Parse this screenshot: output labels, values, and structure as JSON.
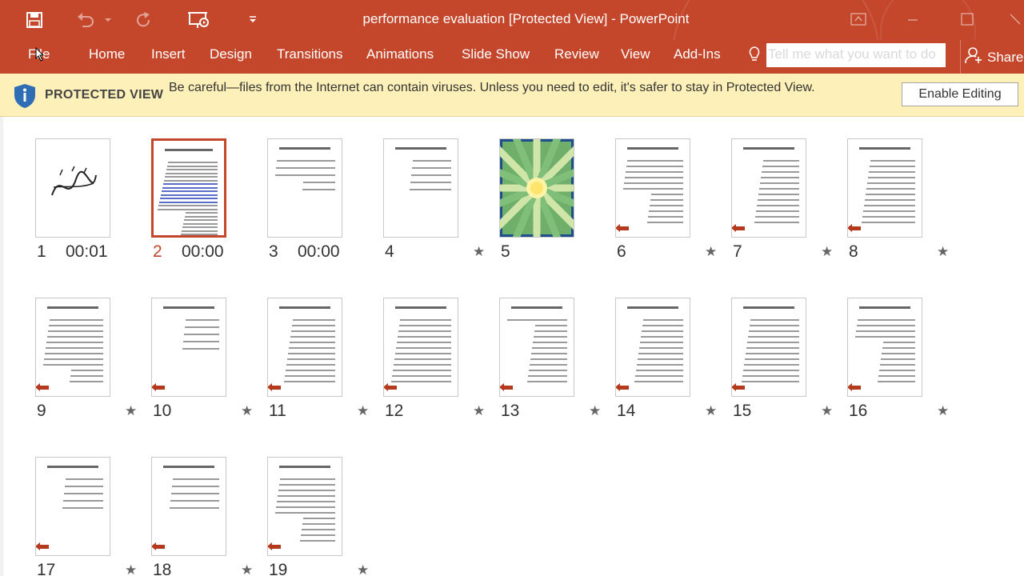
{
  "window": {
    "title": "performance evaluation [Protected View] - PowerPoint"
  },
  "ribbon": {
    "tabs": [
      "File",
      "Home",
      "Insert",
      "Design",
      "Transitions",
      "Animations",
      "Slide Show",
      "Review",
      "View",
      "Add-Ins"
    ],
    "tell_me_placeholder": "Tell me what you want to do",
    "share_label": "Share"
  },
  "protected_view": {
    "title": "PROTECTED VIEW",
    "message": "Be careful—files from the Internet can contain viruses. Unless you need to edit, it's safer to stay in Protected View.",
    "button": "Enable Editing"
  },
  "slides": [
    {
      "num": "1",
      "time": "00:01",
      "star": false
    },
    {
      "num": "2",
      "time": "00:00",
      "star": false,
      "selected": true
    },
    {
      "num": "3",
      "time": "00:00",
      "star": false
    },
    {
      "num": "4",
      "time": "",
      "star": true
    },
    {
      "num": "5",
      "time": "",
      "star": false
    },
    {
      "num": "6",
      "time": "",
      "star": true
    },
    {
      "num": "7",
      "time": "",
      "star": true
    },
    {
      "num": "8",
      "time": "",
      "star": true
    },
    {
      "num": "9",
      "time": "",
      "star": true
    },
    {
      "num": "10",
      "time": "",
      "star": true
    },
    {
      "num": "11",
      "time": "",
      "star": true
    },
    {
      "num": "12",
      "time": "",
      "star": true
    },
    {
      "num": "13",
      "time": "",
      "star": true
    },
    {
      "num": "14",
      "time": "",
      "star": true
    },
    {
      "num": "15",
      "time": "",
      "star": true
    },
    {
      "num": "16",
      "time": "",
      "star": true
    },
    {
      "num": "17",
      "time": "",
      "star": true
    },
    {
      "num": "18",
      "time": "",
      "star": true
    },
    {
      "num": "19",
      "time": "",
      "star": true
    }
  ],
  "colors": {
    "accent": "#c4472c",
    "protected_bar": "#fdf0b8"
  },
  "icons": {
    "save": "save-icon",
    "undo": "undo-icon",
    "redo": "redo-icon",
    "present": "present-from-start-icon",
    "customize": "customize-qat-icon",
    "ribbon_display": "ribbon-display-options-icon",
    "minimize": "minimize-icon",
    "maximize": "maximize-icon",
    "tell_me": "lightbulb-icon",
    "share": "person-add-icon",
    "shield": "shield-icon",
    "star": "star-icon"
  }
}
